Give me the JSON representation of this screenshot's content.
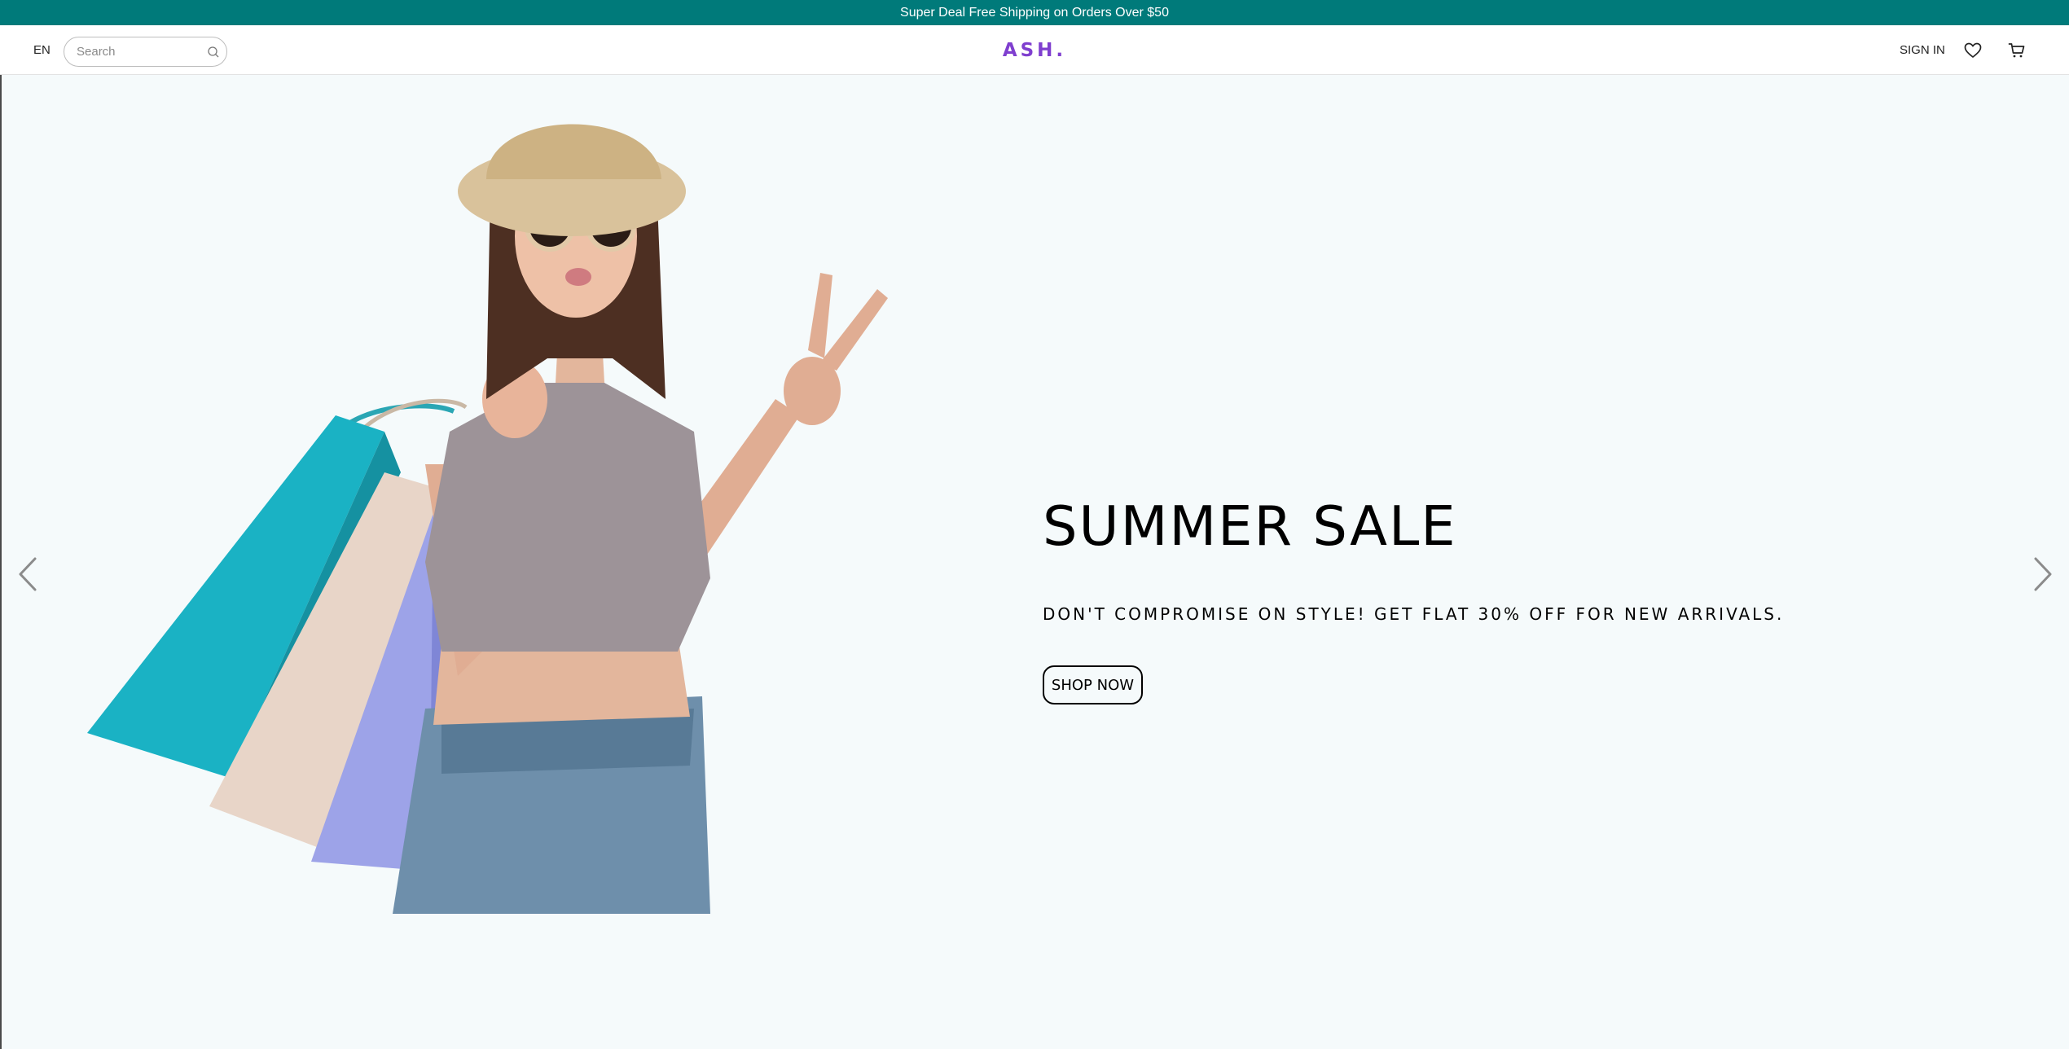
{
  "announcement": {
    "text": "Super Deal Free Shipping on Orders Over $50"
  },
  "navbar": {
    "language": "EN",
    "search": {
      "placeholder": "Search",
      "value": ""
    },
    "logo": "ASH.",
    "signin_label": "SIGN IN",
    "icons": [
      "heart-icon",
      "cart-icon",
      "search-icon"
    ]
  },
  "hero": {
    "title": "SUMMER SALE",
    "subtitle": "DON'T COMPROMISE ON STYLE! GET FLAT 30% OFF FOR NEW ARRIVALS.",
    "cta_label": "SHOP NOW",
    "arrows": [
      "chevron-left-icon",
      "chevron-right-icon"
    ]
  },
  "colors": {
    "announcement_bg": "#007a7a",
    "logo": "#7f3fcf",
    "hero_bg": "#f5fafb",
    "bag_teal": "#1ab2c4",
    "bag_lilac": "#9da3e8"
  }
}
